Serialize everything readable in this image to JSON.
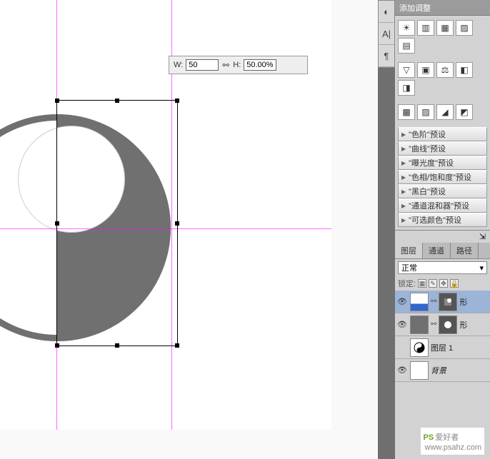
{
  "options": {
    "w_label": "W:",
    "w_value": "50",
    "h_label": "H:",
    "h_value": "50.00%"
  },
  "side_tabs": {
    "a": "◐",
    "b": "A|",
    "c": "¶"
  },
  "adjustments": {
    "title": "添加调整",
    "row1": [
      "☀",
      "▥",
      "▦",
      "▨",
      "▤"
    ],
    "row2": [
      "▽",
      "▣",
      "⚖",
      "◧",
      "◨"
    ],
    "row3": [
      "▩",
      "▨",
      "◢",
      "◩"
    ],
    "presets": [
      "\"色阶\"预设",
      "\"曲线\"预设",
      "\"曝光度\"预设",
      "\"色相/饱和度\"预设",
      "\"黑白\"预设",
      "\"通道混和器\"预设",
      "\"可选颜色\"预设"
    ]
  },
  "layers": {
    "tabs": {
      "a": "图层",
      "b": "通道",
      "c": "路径"
    },
    "blend": "正常",
    "lock": "锁定:",
    "items": [
      {
        "name": "形"
      },
      {
        "name": "形"
      },
      {
        "name": "图层 1"
      },
      {
        "name": "背景"
      }
    ]
  },
  "watermark": {
    "logo": "PS",
    "text": "爱好者",
    "url": "www.psahz.com"
  }
}
